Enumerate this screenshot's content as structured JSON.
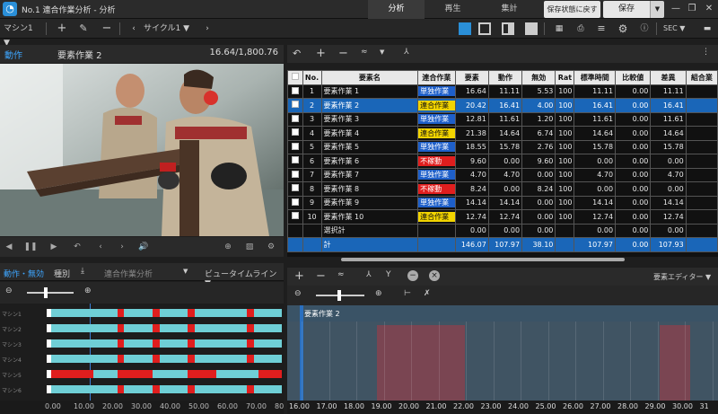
{
  "app": {
    "title": "No.1 連合作業分析 - 分析"
  },
  "mode_tabs": [
    "分析",
    "再生",
    "集計"
  ],
  "header_buttons": {
    "restore": "保存状態に戻す",
    "save": "保存"
  },
  "toolbar": {
    "machine": "マシン1",
    "cycle": "サイクル1",
    "unit": "SEC"
  },
  "video": {
    "tab": "動作",
    "element": "要素作業 2",
    "time": "16.64/1,800.76"
  },
  "timeline": {
    "tab_active": "動作・無効",
    "tab_mark": "種別",
    "tab_analysis": "連合作業分析",
    "view": "ビュータイムライン",
    "rows": [
      "マシン1",
      "マシン2",
      "マシン3",
      "マシン4",
      "マシン5",
      "マシン6"
    ],
    "axis_labels": [
      "0.00",
      "10.00",
      "20.00",
      "30.00",
      "40.00",
      "50.00",
      "60.00",
      "70.00",
      "80"
    ]
  },
  "table": {
    "headers": [
      "",
      "No.",
      "要素名",
      "連合作業",
      "要素",
      "動作",
      "無効",
      "Rat",
      "標準時間",
      "比較値",
      "差異",
      "組合業"
    ],
    "rows": [
      {
        "no": "1",
        "name": "要素作業 1",
        "type": "単独作業",
        "type_color": "#1e5fc9",
        "el": "16.64",
        "mv": "11.11",
        "inv": "5.53",
        "rat": "100",
        "std": "11.11",
        "cmp": "0.00",
        "diff": "11.11"
      },
      {
        "no": "2",
        "name": "要素作業 2",
        "type": "連合作業",
        "type_color": "#f2d400",
        "el": "20.42",
        "mv": "16.41",
        "inv": "4.00",
        "rat": "100",
        "std": "16.41",
        "cmp": "0.00",
        "diff": "16.41"
      },
      {
        "no": "3",
        "name": "要素作業 3",
        "type": "単独作業",
        "type_color": "#1e5fc9",
        "el": "12.81",
        "mv": "11.61",
        "inv": "1.20",
        "rat": "100",
        "std": "11.61",
        "cmp": "0.00",
        "diff": "11.61"
      },
      {
        "no": "4",
        "name": "要素作業 4",
        "type": "連合作業",
        "type_color": "#f2d400",
        "el": "21.38",
        "mv": "14.64",
        "inv": "6.74",
        "rat": "100",
        "std": "14.64",
        "cmp": "0.00",
        "diff": "14.64"
      },
      {
        "no": "5",
        "name": "要素作業 5",
        "type": "単独作業",
        "type_color": "#1e5fc9",
        "el": "18.55",
        "mv": "15.78",
        "inv": "2.76",
        "rat": "100",
        "std": "15.78",
        "cmp": "0.00",
        "diff": "15.78"
      },
      {
        "no": "6",
        "name": "要素作業 6",
        "type": "不稼動",
        "type_color": "#e01e1e",
        "el": "9.60",
        "mv": "0.00",
        "inv": "9.60",
        "rat": "100",
        "std": "0.00",
        "cmp": "0.00",
        "diff": "0.00"
      },
      {
        "no": "7",
        "name": "要素作業 7",
        "type": "単独作業",
        "type_color": "#1e5fc9",
        "el": "4.70",
        "mv": "4.70",
        "inv": "0.00",
        "rat": "100",
        "std": "4.70",
        "cmp": "0.00",
        "diff": "4.70"
      },
      {
        "no": "8",
        "name": "要素作業 8",
        "type": "不稼動",
        "type_color": "#e01e1e",
        "el": "8.24",
        "mv": "0.00",
        "inv": "8.24",
        "rat": "100",
        "std": "0.00",
        "cmp": "0.00",
        "diff": "0.00"
      },
      {
        "no": "9",
        "name": "要素作業 9",
        "type": "単独作業",
        "type_color": "#1e5fc9",
        "el": "14.14",
        "mv": "14.14",
        "inv": "0.00",
        "rat": "100",
        "std": "14.14",
        "cmp": "0.00",
        "diff": "14.14"
      },
      {
        "no": "10",
        "name": "要素作業 10",
        "type": "連合作業",
        "type_color": "#f2d400",
        "el": "12.74",
        "mv": "12.74",
        "inv": "0.00",
        "rat": "100",
        "std": "12.74",
        "cmp": "0.00",
        "diff": "12.74"
      }
    ],
    "sum_row": {
      "label": "選択計",
      "el": "0.00",
      "mv": "0.00",
      "inv": "0.00",
      "std": "0.00",
      "cmp": "0.00",
      "diff": "0.00"
    },
    "total_row": {
      "label": "計",
      "el": "146.07",
      "mv": "107.97",
      "inv": "38.10",
      "std": "107.97",
      "cmp": "0.00",
      "diff": "107.93"
    }
  },
  "editor": {
    "label": "要素エディター",
    "element": "要素作業 2",
    "axis_labels": [
      "16.00",
      "17.00",
      "18.00",
      "19.00",
      "20.00",
      "21.00",
      "22.00",
      "23.00",
      "24.00",
      "25.00",
      "26.00",
      "27.00",
      "28.00",
      "29.00",
      "30.00",
      "31"
    ]
  },
  "colors": {
    "accent": "#3ea6ff",
    "selected_row": "#1a66b8",
    "bar_cyan": "#6fcfd6",
    "bar_red": "#e01e1e"
  }
}
